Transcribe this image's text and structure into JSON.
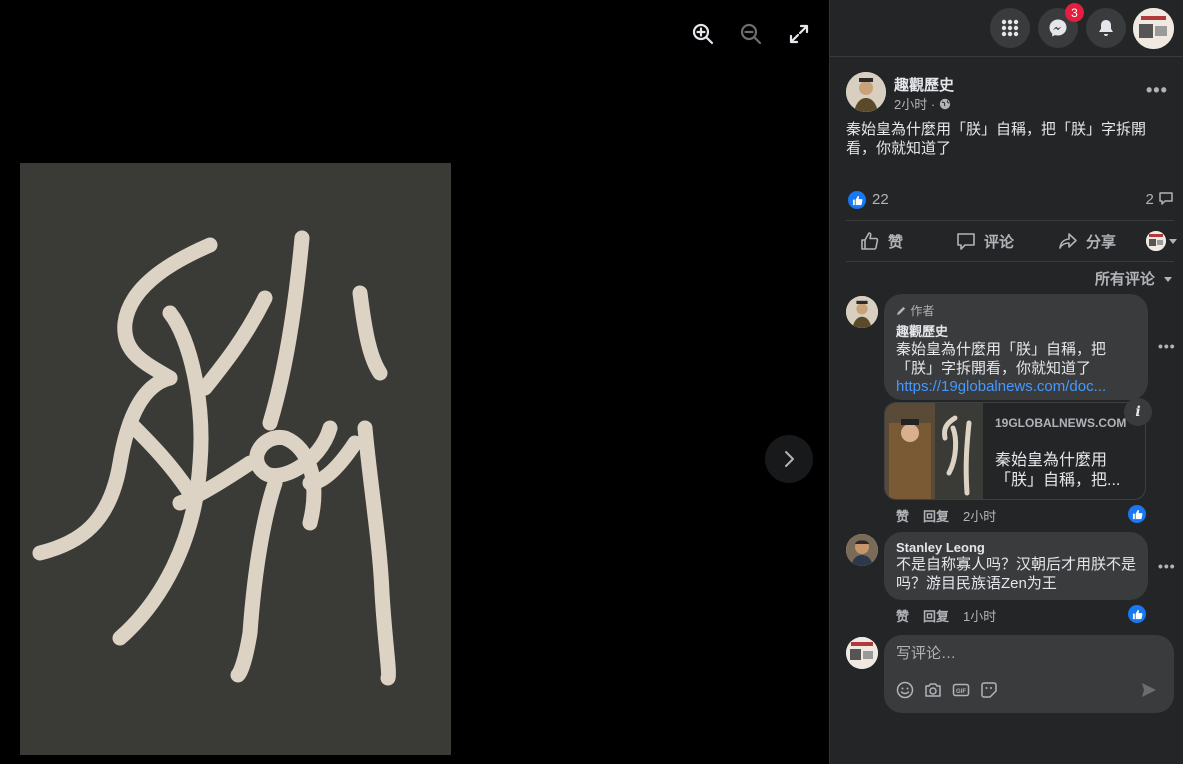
{
  "viewer": {
    "zoom_in_icon": "zoom-in-icon",
    "zoom_out_icon": "zoom-out-icon",
    "fullscreen_icon": "fullscreen-icon",
    "next_icon": "chevron-right-icon"
  },
  "topbar": {
    "menu_icon": "grid-menu-icon",
    "messenger_icon": "messenger-icon",
    "messenger_badge": "3",
    "notifications_icon": "bell-icon"
  },
  "post": {
    "author": "趣觀歷史",
    "time": "2小时 ·",
    "privacy_icon": "globe-icon",
    "text": "秦始皇為什麼用「朕」自稱，把「朕」字拆開看，你就知道了",
    "like_count": "22",
    "comment_count": "2",
    "actions": {
      "like": "赞",
      "comment": "评论",
      "share": "分享"
    },
    "sort_label": "所有评论"
  },
  "comments": [
    {
      "badge": "作者",
      "author": "趣觀歷史",
      "text": "秦始皇為什麼用「朕」自稱，把「朕」字拆開看，你就知道了",
      "link": "https://19globalnews.com/doc...",
      "card_domain": "19GLOBALNEWS.COM",
      "card_title": "秦始皇為什麼用「朕」自稱，把...",
      "like": "赞",
      "reply": "回复",
      "time": "2小时"
    },
    {
      "author": "Stanley Leong",
      "text": "不是自称寡人吗？汉朝后才用朕不是吗？游目民族语Zen为王",
      "like": "赞",
      "reply": "回复",
      "time": "1小时"
    }
  ],
  "composer": {
    "placeholder": "写评论…",
    "tools": [
      "emoji-icon",
      "camera-icon",
      "gif-icon",
      "sticker-icon"
    ],
    "send_icon": "send-icon"
  },
  "colors": {
    "panel_bg": "#242526",
    "bubble_bg": "#3a3b3c",
    "link": "#4599ff",
    "like_blue": "#1877f2",
    "badge_red": "#e41e3f",
    "photo_bg": "#3a3a36",
    "glyph": "#ddd3c4"
  }
}
